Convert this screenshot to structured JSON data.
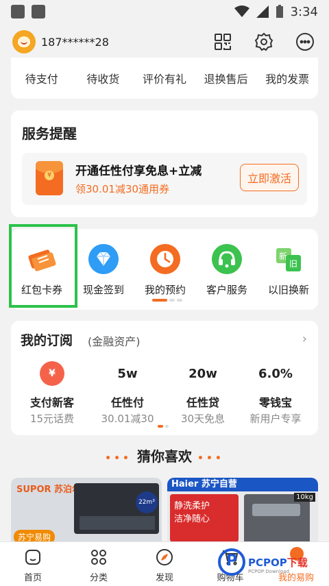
{
  "status": {
    "time": "3:34"
  },
  "header": {
    "phone": "187******28"
  },
  "orders": {
    "items": [
      "待支付",
      "待收货",
      "评价有礼",
      "退换售后",
      "我的发票"
    ]
  },
  "service": {
    "title": "服务提醒",
    "promo_title": "开通任性付享免息+立减",
    "promo_sub": "领30.01减30通用券",
    "promo_button": "立即激活"
  },
  "tools": {
    "items": [
      {
        "label": "红包卡券",
        "icon": "ticket-icon",
        "color": "#f36c21"
      },
      {
        "label": "现金签到",
        "icon": "diamond-icon",
        "color": "#2f9cf5"
      },
      {
        "label": "我的预约",
        "icon": "clock-icon",
        "color": "#f36c21"
      },
      {
        "label": "客户服务",
        "icon": "headset-icon",
        "color": "#3cc24f"
      },
      {
        "label": "以旧换新",
        "icon": "recycle-icon",
        "color": "#3cc24f"
      }
    ]
  },
  "subscription": {
    "title": "我的订阅",
    "subtitle": "(金融资产)",
    "columns": [
      {
        "top": "",
        "name": "支付新客",
        "desc": "15元话费"
      },
      {
        "top": "5w",
        "name": "任性付",
        "desc": "30.01减30"
      },
      {
        "top": "20w",
        "name": "任性贷",
        "desc": "30天免息"
      },
      {
        "top": "6.0%",
        "name": "零钱宝",
        "desc": "新用户专享"
      }
    ]
  },
  "guess": {
    "title": "猜你喜欢"
  },
  "products": {
    "p1_brand": "SUPOR 苏泊尔",
    "p1_bubble": "22m³",
    "p1_badge": "苏宁易购",
    "p2_brand": "Haier 苏宁自营",
    "p2_text1": "静洗柔护",
    "p2_text2": "洁净随心",
    "p2_tag": "10kg"
  },
  "tabbar": {
    "items": [
      {
        "label": "首页"
      },
      {
        "label": "分类"
      },
      {
        "label": "发现"
      },
      {
        "label": "购物车"
      },
      {
        "label": "我的易购"
      }
    ]
  },
  "watermark": {
    "brand": "PCPOP",
    "suffix": "下载",
    "small": "PCPOP Download"
  },
  "colors": {
    "accent": "#f36c21",
    "highlight": "#2cc24a"
  }
}
